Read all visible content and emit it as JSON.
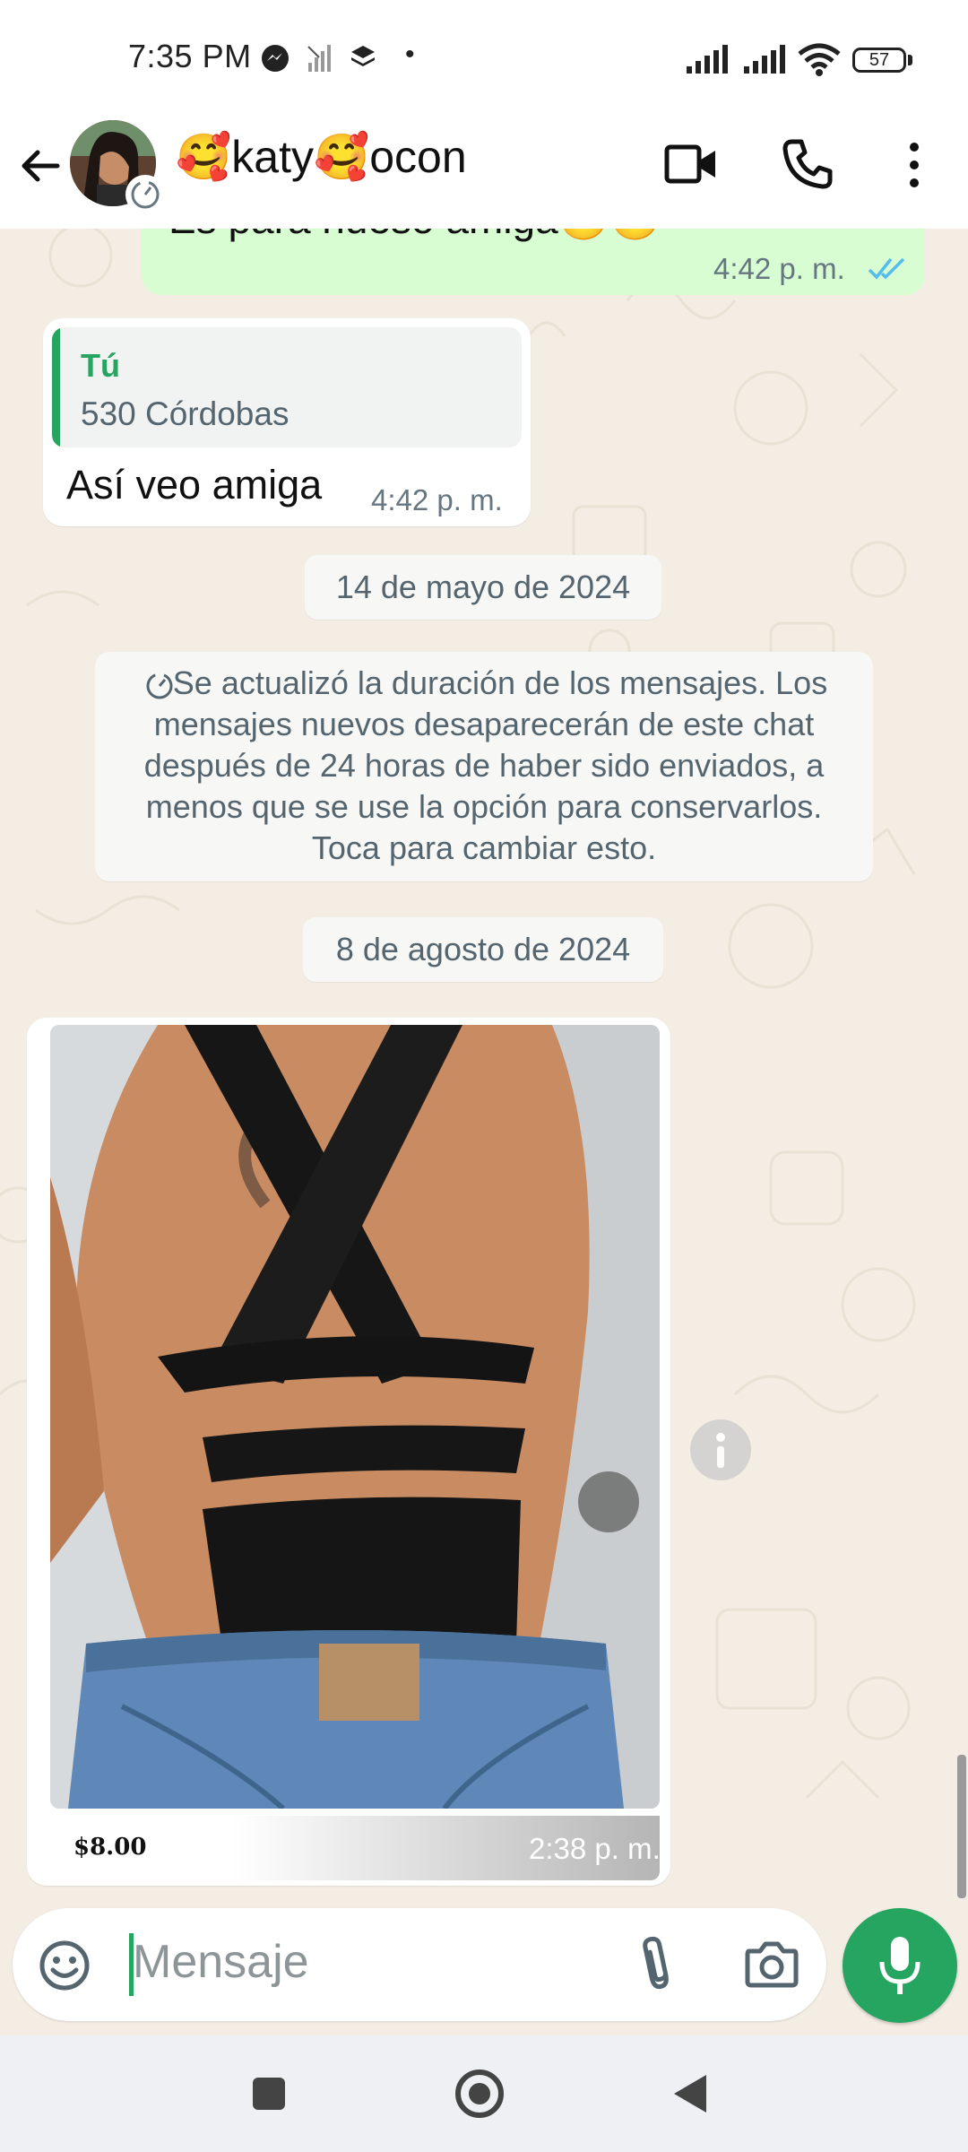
{
  "status_bar": {
    "time": "7:35 PM",
    "dot": "•",
    "battery": "57",
    "icons": [
      "messenger-icon",
      "signal-off-icon",
      "layers-icon",
      "signal-icon",
      "signal-icon",
      "wifi-icon",
      "battery-icon"
    ]
  },
  "header": {
    "contact_name": "🥰katy🥰ocon",
    "icons": [
      "back-arrow-icon",
      "video-call-icon",
      "phone-icon",
      "more-vertical-icon"
    ]
  },
  "messages": {
    "outgoing_partial": {
      "text": "Es para nueso amiga🤒🤒",
      "time": "4:42 p. m."
    },
    "reply": {
      "quote_author": "Tú",
      "quote_text": "530 Córdobas",
      "text": "Así veo amiga",
      "time": "4:42 p. m."
    },
    "date_1": "14 de mayo de 2024",
    "system": "Se actualizó la duración de los mensajes. Los mensajes nuevos desaparecerán de este chat después de 24 horas de haber sido enviados, a menos que se use la opción para conservarlos. Toca para cambiar esto.",
    "date_2": "8 de agosto de 2024",
    "image": {
      "price": "$8.00",
      "time": "2:38 p. m."
    }
  },
  "composer": {
    "placeholder": "Mensaje",
    "icons": [
      "emoji-icon",
      "attach-icon",
      "camera-icon",
      "microphone-icon"
    ]
  },
  "colors": {
    "accent": "#25a55f",
    "outgoing_bubble": "#d8fdd2",
    "chat_background": "#f3ede3",
    "read_ticks": "#53bdeb"
  }
}
